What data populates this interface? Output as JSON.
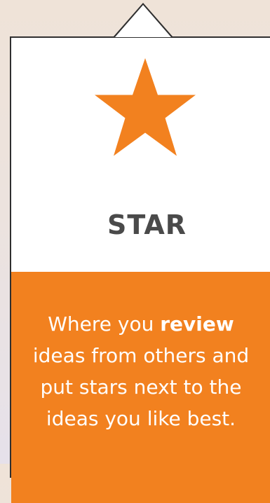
{
  "card": {
    "title": "STAR",
    "icon": "star-icon",
    "accent_color": "#F2811F",
    "description": {
      "line1_prefix": "Where you ",
      "line1_emphasis": "review",
      "line2": "ideas from others and",
      "line3": "put stars next to the",
      "line4": "ideas you like best."
    }
  }
}
